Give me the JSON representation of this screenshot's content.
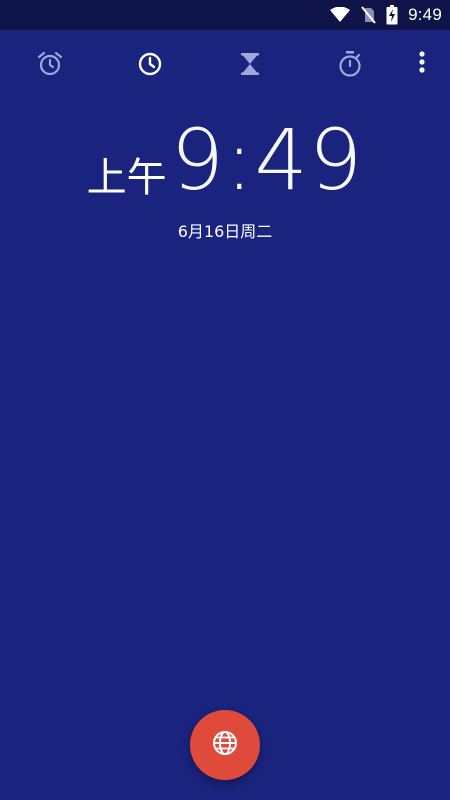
{
  "status_bar": {
    "time": "9:49",
    "icons": [
      "wifi-icon",
      "no-sim-icon",
      "battery-charging-icon"
    ]
  },
  "tabs": [
    {
      "name": "alarm",
      "icon": "alarm-icon",
      "selected": false
    },
    {
      "name": "clock",
      "icon": "clock-icon",
      "selected": true
    },
    {
      "name": "timer",
      "icon": "hourglass-icon",
      "selected": false
    },
    {
      "name": "stopwatch",
      "icon": "stopwatch-icon",
      "selected": false
    }
  ],
  "overflow_icon": "more-vert-icon",
  "clock": {
    "ampm": "上午",
    "time": "9:49",
    "date": "6月16日周二"
  },
  "fab": {
    "icon": "globe-icon"
  },
  "colors": {
    "background": "#1a237e",
    "status_bar": "#0e1447",
    "fab": "#e04a3a",
    "tab_inactive": "#9fa8da",
    "tab_active": "#ffffff"
  }
}
